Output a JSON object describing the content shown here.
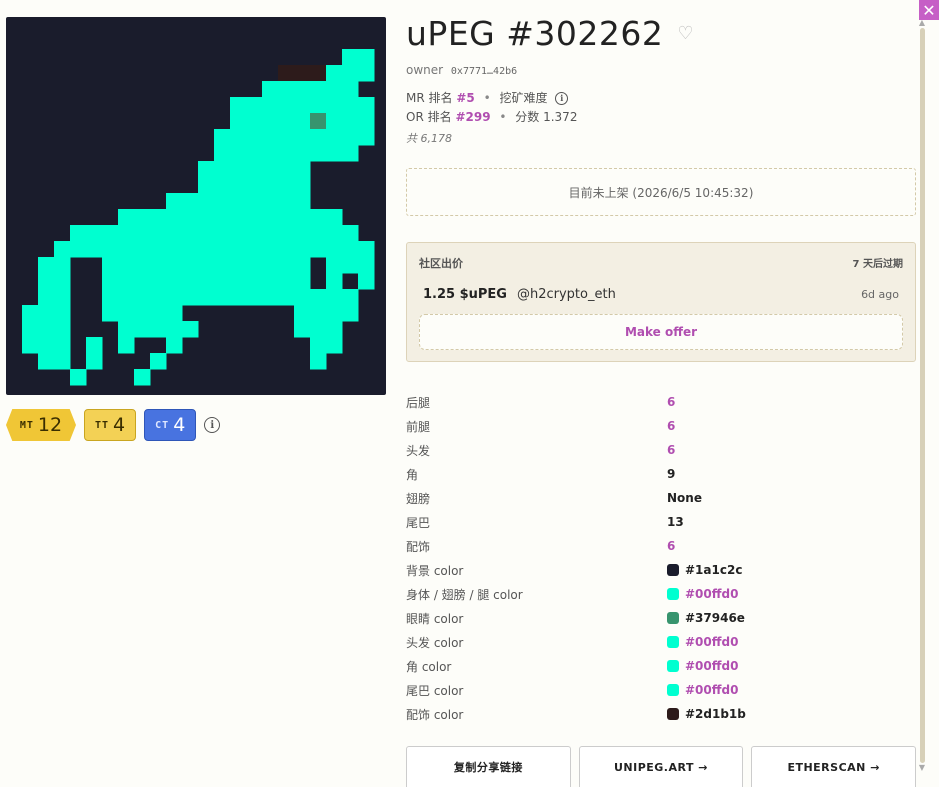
{
  "art": {
    "bg_color": "#1a1c2c",
    "body_color": "#00ffd0",
    "eye_color": "#37946e",
    "accessory_color": "#2d1b1b"
  },
  "badges": [
    {
      "key": "MT",
      "value": "12"
    },
    {
      "key": "TT",
      "value": "4"
    },
    {
      "key": "CT",
      "value": "4"
    }
  ],
  "title": "uPEG #302262",
  "owner": {
    "label": "owner",
    "address": "0x7771…42b6"
  },
  "rank": {
    "mr_label": "MR 排名",
    "mr_value": "#5",
    "mining_label": "挖矿难度",
    "or_label": "OR 排名",
    "or_value": "#299",
    "score_label": "分数 1.372",
    "total": "共 6,178"
  },
  "listing_status": "目前未上架 (2026/6/5 10:45:32)",
  "offers": {
    "title": "社区出价",
    "expiry": "7 天后过期",
    "amount": "1.25 $uPEG",
    "user": "@h2crypto_eth",
    "ago": "6d ago",
    "make_offer": "Make offer"
  },
  "traits": [
    {
      "key": "后腿",
      "value": "6",
      "link": true
    },
    {
      "key": "前腿",
      "value": "6",
      "link": true
    },
    {
      "key": "头发",
      "value": "6",
      "link": true
    },
    {
      "key": "角",
      "value": "9",
      "link": false
    },
    {
      "key": "翅膀",
      "value": "None",
      "link": false
    },
    {
      "key": "尾巴",
      "value": "13",
      "link": false
    },
    {
      "key": "配饰",
      "value": "6",
      "link": true
    },
    {
      "key": "背景 color",
      "value": "#1a1c2c",
      "link": false,
      "swatch": "#1a1c2c"
    },
    {
      "key": "身体 / 翅膀 / 腿 color",
      "value": "#00ffd0",
      "link": true,
      "swatch": "#00ffd0"
    },
    {
      "key": "眼睛 color",
      "value": "#37946e",
      "link": false,
      "swatch": "#37946e"
    },
    {
      "key": "头发 color",
      "value": "#00ffd0",
      "link": true,
      "swatch": "#00ffd0"
    },
    {
      "key": "角 color",
      "value": "#00ffd0",
      "link": true,
      "swatch": "#00ffd0"
    },
    {
      "key": "尾巴 color",
      "value": "#00ffd0",
      "link": true,
      "swatch": "#00ffd0"
    },
    {
      "key": "配饰 color",
      "value": "#2d1b1b",
      "link": false,
      "swatch": "#2d1b1b"
    }
  ],
  "actions": {
    "copy": "复制分享链接",
    "unipeg": "UNIPEG.ART →",
    "etherscan": "ETHERSCAN →"
  }
}
